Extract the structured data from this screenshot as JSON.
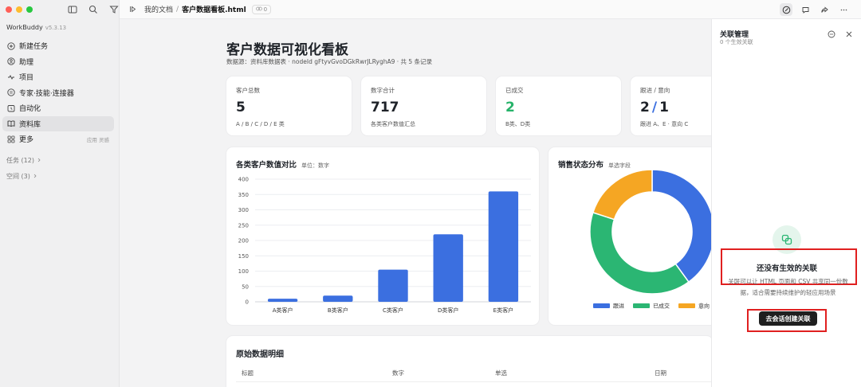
{
  "sidebar": {
    "app_name": "WorkBuddy",
    "version": "v5.3.13",
    "items": [
      {
        "label": "新建任务",
        "icon": "plus-circle-icon"
      },
      {
        "label": "助理",
        "icon": "assistant-icon"
      },
      {
        "label": "项目",
        "icon": "project-icon"
      },
      {
        "label": "专家·技能·连接器",
        "icon": "expert-icon"
      },
      {
        "label": "自动化",
        "icon": "clock-icon"
      },
      {
        "label": "资料库",
        "icon": "book-icon"
      },
      {
        "label": "更多",
        "icon": "grid-icon",
        "hint": "应用 灵感"
      }
    ],
    "groups": [
      {
        "label": "任务 (12)"
      },
      {
        "label": "空间 (3)"
      }
    ]
  },
  "topbar": {
    "breadcrumb_root": "我的文档",
    "breadcrumb_sep": "/",
    "breadcrumb_current": "客户数据看板.html",
    "badge_count": "0"
  },
  "main": {
    "title": "客户数据可视化看板",
    "subtitle": "数据源：资料库数据表 · nodeId gFtyvGvoDGkRwrJLRyghA9 · 共 5 条记录",
    "stats": [
      {
        "label": "客户总数",
        "value": "5",
        "desc": "A / B / C / D / E 类"
      },
      {
        "label": "数字合计",
        "value": "717",
        "desc": "各类客户数值汇总"
      },
      {
        "label": "已成交",
        "value": "2",
        "desc": "B类、D类"
      },
      {
        "label": "跟进 / 意向",
        "value_a": "2",
        "value_sep": "/",
        "value_b": "1",
        "desc": "跟进 A、E · 意向 C"
      }
    ],
    "bar_card": {
      "title": "各类客户数值对比",
      "subtitle": "单位：数字"
    },
    "donut_card": {
      "title": "销售状态分布",
      "subtitle": "单选字段"
    },
    "table": {
      "title": "原始数据明细",
      "headers": [
        "标题",
        "数字",
        "单选",
        "日期"
      ]
    }
  },
  "chart_data": [
    {
      "type": "bar",
      "title": "各类客户数值对比",
      "categories": [
        "A类客户",
        "B类客户",
        "C类客户",
        "D类客户",
        "E类客户"
      ],
      "values": [
        10,
        20,
        105,
        220,
        360
      ],
      "ylim": [
        0,
        400
      ],
      "yticks": [
        0,
        50,
        100,
        150,
        200,
        250,
        300,
        350,
        400
      ],
      "color": "#3b6fe0",
      "grid": true
    },
    {
      "type": "pie",
      "title": "销售状态分布",
      "donut": true,
      "slices": [
        {
          "name": "跟进",
          "value": 2,
          "color": "#3b6fe0"
        },
        {
          "name": "已成交",
          "value": 2,
          "color": "#2bb673"
        },
        {
          "name": "意向",
          "value": 1,
          "color": "#f5a623"
        }
      ],
      "legend": "bottom"
    }
  ],
  "right_panel": {
    "title": "关联管理",
    "subtitle": "0 个生效关联",
    "empty_title": "还没有生效的关联",
    "empty_desc": "关联可以让 HTML 页面和 CSV 共享同一份数据，适合需要持续维护的轻应用场景",
    "button": "去会话创建关联"
  }
}
